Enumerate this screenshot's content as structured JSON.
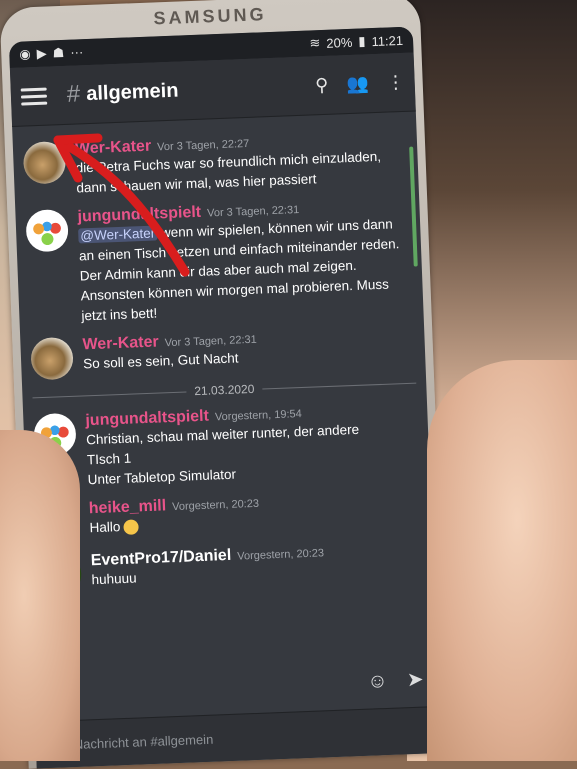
{
  "device": {
    "brand": "SAMSUNG"
  },
  "statusbar": {
    "battery": "20%",
    "time": "11:21"
  },
  "appbar": {
    "hash": "#",
    "channel": "allgemein"
  },
  "messages": [
    {
      "author": "Wer-Kater",
      "time": "Vor 3 Tagen, 22:27",
      "text": "die Petra Fuchs war so freundlich mich einzuladen, dann schauen wir mal, was hier passiert"
    },
    {
      "author": "jungundaltspielt",
      "time": "Vor 3 Tagen, 22:31",
      "mention": "@Wer-Kater",
      "text": " wenn wir spielen, können wir uns dann an einen Tisch setzen und einfach miteinander reden. Der Admin kann dir das aber auch mal zeigen. Ansonsten können wir morgen mal probieren.  Muss jetzt ins bett!"
    },
    {
      "author": "Wer-Kater",
      "time": "Vor 3 Tagen, 22:31",
      "text": "So soll es sein, Gut Nacht"
    },
    {
      "author": "jungundaltspielt",
      "time": "Vorgestern, 19:54",
      "line1": "Christian, schau mal weiter runter, der andere",
      "line2": "TIsch 1",
      "line3": "Unter Tabletop Simulator"
    },
    {
      "author": "heike_mill",
      "time": "Vorgestern, 20:23",
      "text": "Hallo"
    },
    {
      "author": "EventPro17/Daniel",
      "time": "Vorgestern, 20:23",
      "text": "huhuuu"
    }
  ],
  "date_divider": "21.03.2020",
  "composer": {
    "placeholder": "Nachricht an #allgemein"
  },
  "colors": {
    "username_pink": "#e8548a",
    "arrow_red": "#d81d1d",
    "background": "#36393f"
  },
  "icons": [
    "hamburger-icon",
    "search-icon",
    "members-icon",
    "more-icon",
    "emoji-icon",
    "send-icon",
    "plus-icon"
  ]
}
